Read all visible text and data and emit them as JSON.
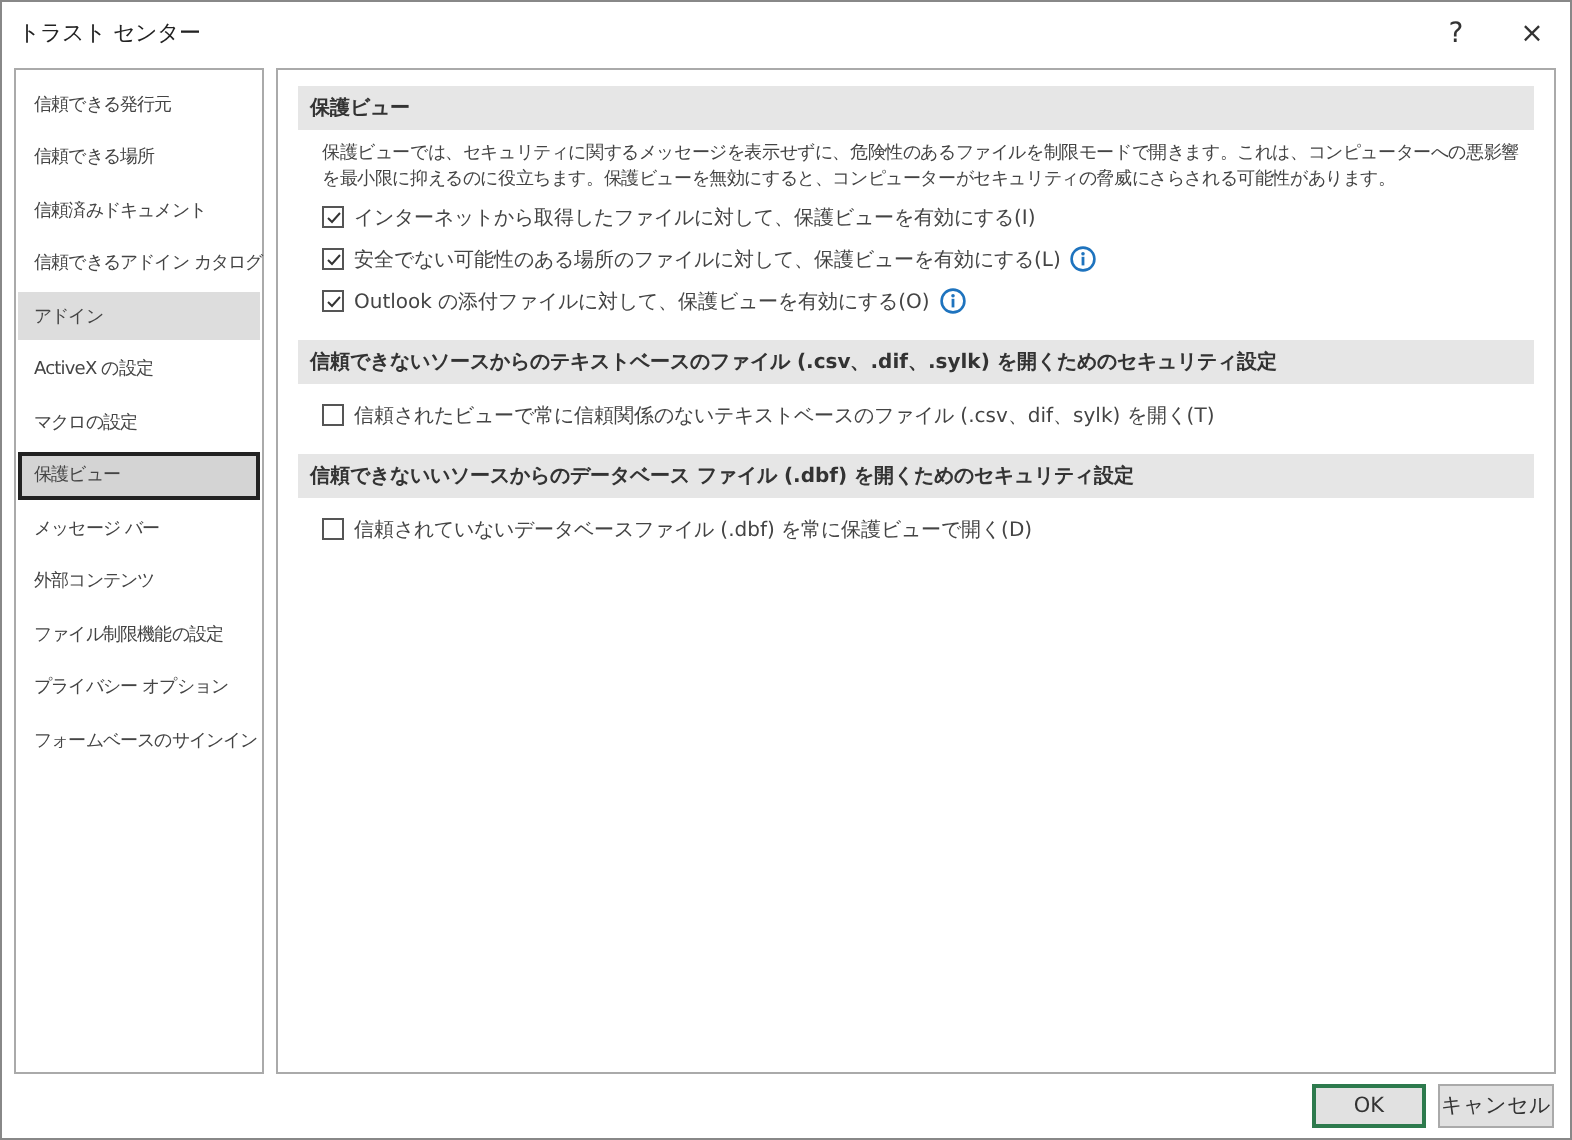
{
  "window": {
    "title": "トラスト センター",
    "help": "?",
    "close": "×"
  },
  "sidebar": {
    "items": [
      {
        "label": "信頼できる発行元",
        "selected": false,
        "hover": false
      },
      {
        "label": "信頼できる場所",
        "selected": false,
        "hover": false
      },
      {
        "label": "信頼済みドキュメント",
        "selected": false,
        "hover": false
      },
      {
        "label": "信頼できるアドイン カタログ",
        "selected": false,
        "hover": false
      },
      {
        "label": "アドイン",
        "selected": false,
        "hover": true
      },
      {
        "label": "ActiveX の設定",
        "selected": false,
        "hover": false
      },
      {
        "label": "マクロの設定",
        "selected": false,
        "hover": false
      },
      {
        "label": "保護ビュー",
        "selected": true,
        "hover": false
      },
      {
        "label": "メッセージ バー",
        "selected": false,
        "hover": false
      },
      {
        "label": "外部コンテンツ",
        "selected": false,
        "hover": false
      },
      {
        "label": "ファイル制限機能の設定",
        "selected": false,
        "hover": false
      },
      {
        "label": "プライバシー オプション",
        "selected": false,
        "hover": false
      },
      {
        "label": "フォームベースのサインイン",
        "selected": false,
        "hover": false
      }
    ]
  },
  "sections": [
    {
      "heading": "保護ビュー",
      "description": "保護ビューでは、セキュリティに関するメッセージを表示せずに、危険性のあるファイルを制限モードで開きます。これは、コンピューターへの悪影響を最小限に抑えるのに役立ちます。保護ビューを無効にすると、コンピューターがセキュリティの脅威にさらされる可能性があります。",
      "options": [
        {
          "label": "インターネットから取得したファイルに対して、保護ビューを有効にする(I)",
          "checked": true,
          "info": false
        },
        {
          "label": "安全でない可能性のある場所のファイルに対して、保護ビューを有効にする(L)",
          "checked": true,
          "info": true
        },
        {
          "label": "Outlook の添付ファイルに対して、保護ビューを有効にする(O)",
          "checked": true,
          "info": true
        }
      ]
    },
    {
      "heading": "信頼できないソースからのテキストベースのファイル (.csv、.dif、.sylk) を開くためのセキュリティ設定",
      "options": [
        {
          "label": "信頼されたビューで常に信頼関係のないテキストベースのファイル (.csv、dif、sylk) を開く(T)",
          "checked": false,
          "info": false
        }
      ]
    },
    {
      "heading": "信頼できないいソースからのデータベース ファイル (.dbf) を開くためのセキュリティ設定",
      "options": [
        {
          "label": "信頼されていないデータベースファイル (.dbf) を常に保護ビューで開く(D)",
          "checked": false,
          "info": false
        }
      ]
    }
  ],
  "buttons": [
    {
      "label": "OK",
      "default": true
    },
    {
      "label": "キャンセル",
      "default": false
    }
  ]
}
